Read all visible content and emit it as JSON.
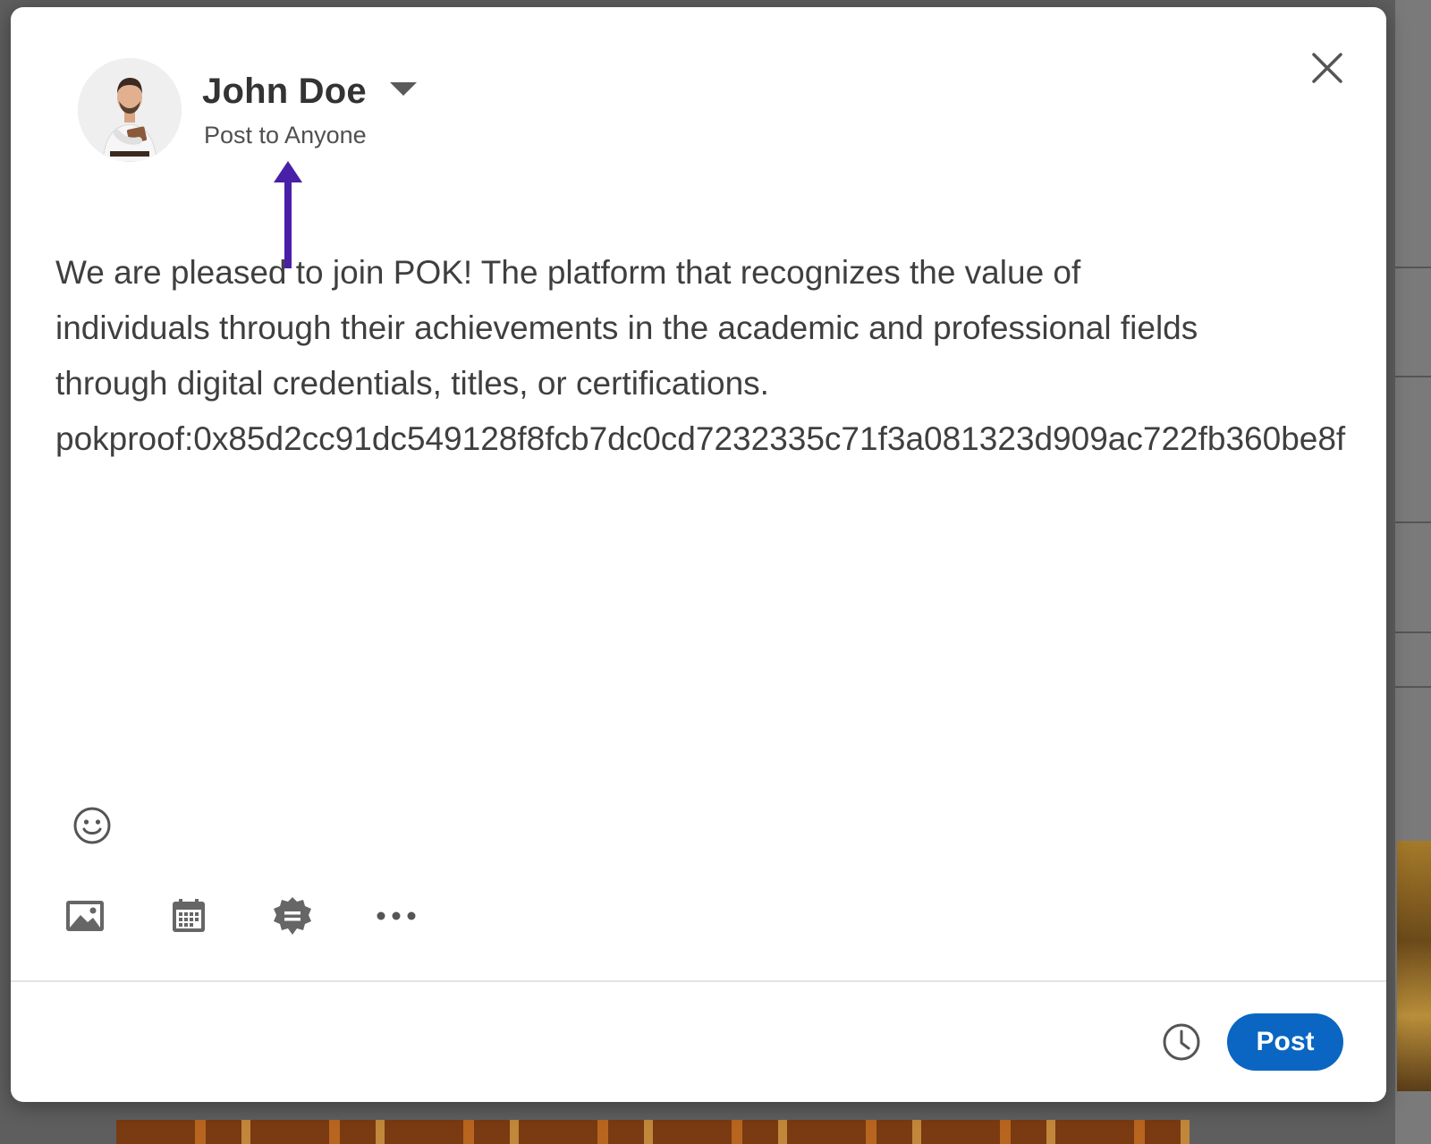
{
  "composer": {
    "author": {
      "name": "John Doe",
      "visibility": "Post to Anyone"
    },
    "body": {
      "line1": "We are pleased to join POK! The platform that recognizes the value of",
      "line2": "individuals through their achievements in the academic and professional fields",
      "line3": "through digital credentials, titles, or certifications.",
      "proof": "pokproof:0x85d2cc91dc549128f8fcb7dc0cd7232335c71f3a081323d909ac722fb360be8f"
    },
    "footer": {
      "post_label": "Post"
    }
  },
  "icons": {
    "close": "close-icon",
    "caret": "chevron-down-icon",
    "emoji": "emoji-icon",
    "media": "image-icon",
    "event": "calendar-icon",
    "celebrate": "badge-icon",
    "more": "more-icon",
    "schedule": "clock-icon"
  },
  "colors": {
    "primary": "#0a66c2",
    "annotation_arrow": "#4a1fa8",
    "text": "#3f3f3f",
    "icon": "#666666"
  }
}
